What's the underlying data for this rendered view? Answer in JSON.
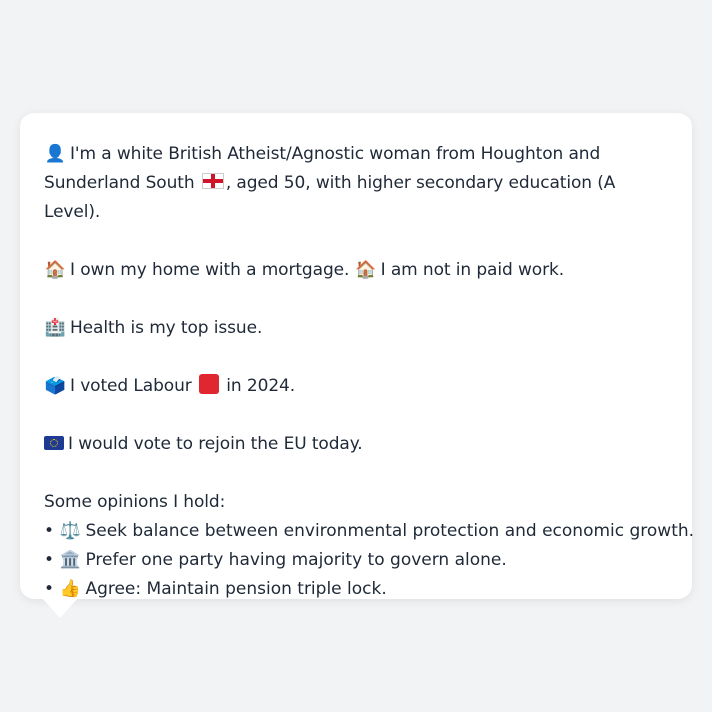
{
  "persona": {
    "intro_icon": "👤",
    "intro_text_before_flag": "I'm a white British Atheist/Agnostic woman from Houghton and Sunderland South",
    "intro_flag_icon": "england-flag-icon",
    "intro_text_after_flag": ", aged 50, with higher secondary education (A Level).",
    "home_icon": "🏠",
    "home_text": "I own my home with a mortgage.",
    "work_icon": "🏠",
    "work_text": "I am not in paid work.",
    "health_icon": "🏥",
    "health_text": "Health is my top issue.",
    "vote_icon": "🗳️",
    "vote_text_before": "I voted Labour",
    "vote_party_icon": "red-square-icon",
    "vote_text_after": "in 2024.",
    "eu_icon": "eu-flag-icon",
    "eu_text": "I would vote to rejoin the EU today.",
    "opinions_heading": "Some opinions I hold:",
    "bullet": "•",
    "opinions": [
      {
        "icon": "⚖️",
        "text": "Seek balance between environmental protection and economic growth."
      },
      {
        "icon": "🏛️",
        "text": "Prefer one party having majority to govern alone."
      },
      {
        "icon": "👍",
        "text": "Agree: Maintain pension triple lock."
      }
    ]
  },
  "colors": {
    "background": "#f2f3f5",
    "bubble": "#ffffff",
    "text": "#1f2937",
    "labour_red": "#e0262f",
    "eu_blue": "#1f3a93"
  }
}
